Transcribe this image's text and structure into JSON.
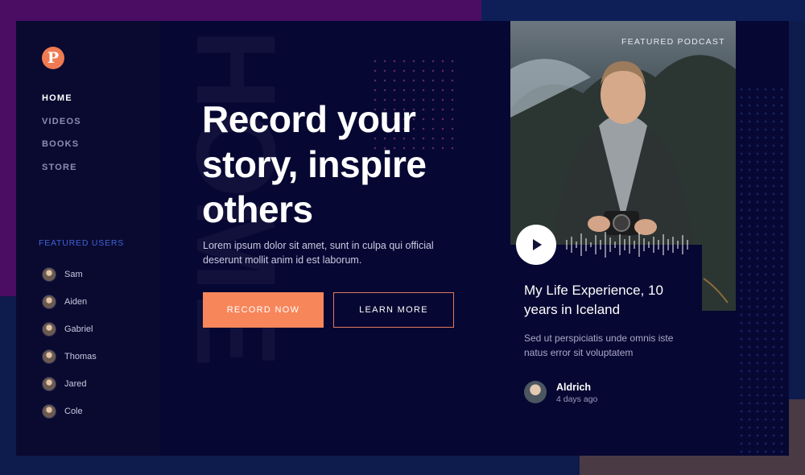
{
  "brand": {
    "logo_letter": "P"
  },
  "nav": {
    "items": [
      {
        "label": "HOME",
        "active": true
      },
      {
        "label": "VIDEOS",
        "active": false
      },
      {
        "label": "BOOKS",
        "active": false
      },
      {
        "label": "STORE",
        "active": false
      }
    ]
  },
  "featured_users": {
    "heading": "FEATURED USERS",
    "users": [
      "Sam",
      "Aiden",
      "Gabriel",
      "Thomas",
      "Jared",
      "Cole"
    ]
  },
  "hero": {
    "ghost_word": "HOME",
    "headline": "Record your story, inspire others",
    "lead": "Lorem ipsum dolor sit amet, sunt in culpa qui official deserunt mollit anim id est laborum.",
    "primary_button": "RECORD NOW",
    "secondary_button": "LEARN MORE"
  },
  "podcast": {
    "label": "FEATURED PODCAST",
    "title": "My Life Experience, 10 years in Iceland",
    "description": "Sed ut perspiciatis unde omnis iste natus error sit voluptatem",
    "author": "Aldrich",
    "time": "4 days ago"
  },
  "colors": {
    "accent": "#f7865a",
    "card_bg": "#070733",
    "featured_heading": "#3f63d6",
    "purple_bg": "#4a0d63"
  },
  "icons": [
    "play-icon"
  ]
}
